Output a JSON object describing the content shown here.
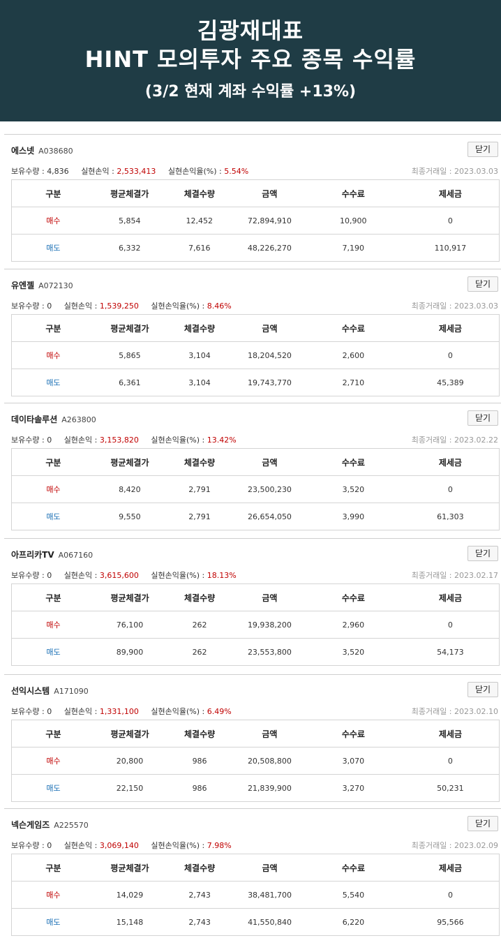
{
  "banner": {
    "line1": "김광재대표",
    "line2": "HINT 모의투자 주요 종목 수익률",
    "line3": "(3/2 현재 계좌 수익률 +13%)"
  },
  "labels": {
    "close": "닫기",
    "holding": "보유수량 : ",
    "profit": "실현손익 : ",
    "profit_rate": "실현손익율(%) : ",
    "last_trade": "최종거래일 : ",
    "buy": "매수",
    "sell": "매도"
  },
  "table_headers": [
    "구분",
    "평균체결가",
    "체결수량",
    "금액",
    "수수료",
    "제세금"
  ],
  "stocks": [
    {
      "name": "에스넷",
      "code": "A038680",
      "holding": "4,836",
      "profit": "2,533,413",
      "rate": "5.54%",
      "last_trade": "2023.03.03",
      "buy": [
        "5,854",
        "12,452",
        "72,894,910",
        "10,900",
        "0"
      ],
      "sell": [
        "6,332",
        "7,616",
        "48,226,270",
        "7,190",
        "110,917"
      ]
    },
    {
      "name": "유엔젤",
      "code": "A072130",
      "holding": "0",
      "profit": "1,539,250",
      "rate": "8.46%",
      "last_trade": "2023.03.03",
      "buy": [
        "5,865",
        "3,104",
        "18,204,520",
        "2,600",
        "0"
      ],
      "sell": [
        "6,361",
        "3,104",
        "19,743,770",
        "2,710",
        "45,389"
      ]
    },
    {
      "name": "데이타솔루션",
      "code": "A263800",
      "holding": "0",
      "profit": "3,153,820",
      "rate": "13.42%",
      "last_trade": "2023.02.22",
      "buy": [
        "8,420",
        "2,791",
        "23,500,230",
        "3,520",
        "0"
      ],
      "sell": [
        "9,550",
        "2,791",
        "26,654,050",
        "3,990",
        "61,303"
      ]
    },
    {
      "name": "아프리카TV",
      "code": "A067160",
      "holding": "0",
      "profit": "3,615,600",
      "rate": "18.13%",
      "last_trade": "2023.02.17",
      "buy": [
        "76,100",
        "262",
        "19,938,200",
        "2,960",
        "0"
      ],
      "sell": [
        "89,900",
        "262",
        "23,553,800",
        "3,520",
        "54,173"
      ]
    },
    {
      "name": "선익시스템",
      "code": "A171090",
      "holding": "0",
      "profit": "1,331,100",
      "rate": "6.49%",
      "last_trade": "2023.02.10",
      "buy": [
        "20,800",
        "986",
        "20,508,800",
        "3,070",
        "0"
      ],
      "sell": [
        "22,150",
        "986",
        "21,839,900",
        "3,270",
        "50,231"
      ]
    },
    {
      "name": "넥슨게임즈",
      "code": "A225570",
      "holding": "0",
      "profit": "3,069,140",
      "rate": "7.98%",
      "last_trade": "2023.02.09",
      "buy": [
        "14,029",
        "2,743",
        "38,481,700",
        "5,540",
        "0"
      ],
      "sell": [
        "15,148",
        "2,743",
        "41,550,840",
        "6,220",
        "95,566"
      ]
    }
  ]
}
